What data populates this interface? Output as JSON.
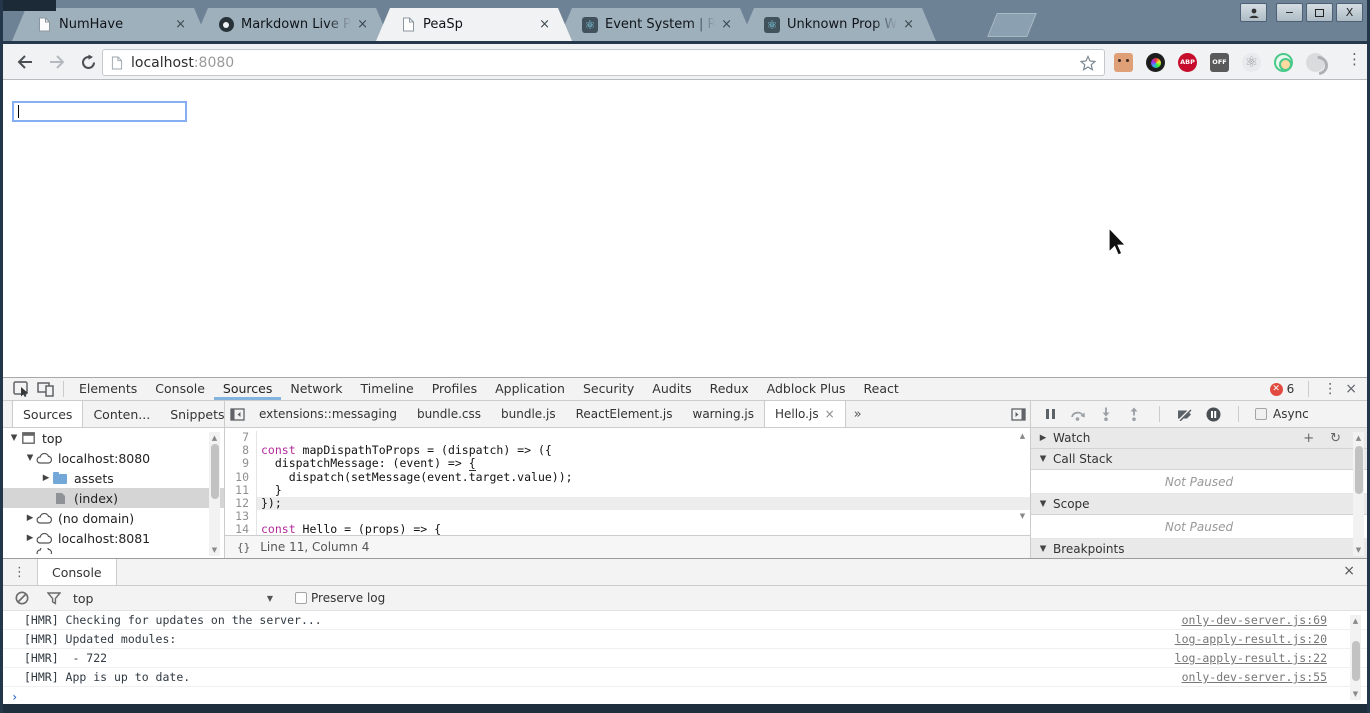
{
  "colors": {
    "frame": "#6e8296",
    "frame_dark": "#1f2e3d",
    "active_tab": "#f1f2f3",
    "tab_underline": "#84b3dd",
    "error_red": "#e04a3f",
    "keyword_magenta": "#b22a9a",
    "prompt_blue": "#3b6fd4",
    "focus_ring_blue": "#85aff2",
    "selected_row_gray": "#d5d5d5"
  },
  "browser": {
    "close_glyph": "×",
    "tabs": [
      {
        "title": "NumHave",
        "icon": "page-icon"
      },
      {
        "title": "Markdown Live Pre",
        "icon": "markdown-icon"
      },
      {
        "title": "PeaSp",
        "icon": "page-icon"
      },
      {
        "title": "Event System | Rea",
        "icon": "react-icon"
      },
      {
        "title": "Unknown Prop War",
        "icon": "react-icon"
      }
    ],
    "window_controls": {
      "minimize": "−",
      "close": "X"
    },
    "url": {
      "host": "localhost",
      "port": ":8080"
    },
    "extensions": [
      "face-icon",
      "color-picker-icon",
      "adblock-plus-icon",
      "off-icon",
      "react-gray-icon",
      "target-icon",
      "swirl-icon"
    ],
    "ext_labels": {
      "abp": "ABP",
      "off": "OFF",
      "react": "⚛"
    },
    "menu_glyph": "⋮"
  },
  "page": {
    "input_value": ""
  },
  "devtools": {
    "tabs": [
      "Elements",
      "Console",
      "Sources",
      "Network",
      "Timeline",
      "Profiles",
      "Application",
      "Security",
      "Audits",
      "Redux",
      "Adblock Plus",
      "React"
    ],
    "active_tab": "Sources",
    "error_count": "6",
    "menu_glyph": "⋮",
    "close_glyph": "×",
    "sources_nav": {
      "tabs": [
        "Sources",
        "Conten...",
        "Snippets"
      ],
      "menu_glyph": "⋮"
    },
    "tree": [
      {
        "arrow": "▼",
        "label": "top",
        "icon": "frame-icon"
      },
      {
        "arrow": "▼",
        "label": "localhost:8080",
        "icon": "cloud-icon"
      },
      {
        "arrow": "▶",
        "label": "assets",
        "icon": "folder-icon"
      },
      {
        "arrow": "",
        "label": "(index)",
        "icon": "file-icon"
      },
      {
        "arrow": "▶",
        "label": "(no domain)",
        "icon": "cloud-icon"
      },
      {
        "arrow": "▶",
        "label": "localhost:8081",
        "icon": "cloud-icon"
      }
    ],
    "editor": {
      "tabs": [
        "extensions::messaging",
        "bundle.css",
        "bundle.js",
        "ReactElement.js",
        "warning.js"
      ],
      "active_tab": "Hello.js",
      "close_glyph": "×",
      "overflow_glyph": "»",
      "code_lines": [
        {
          "n": "7",
          "kw": "",
          "pre": "",
          "post": "",
          "u": ""
        },
        {
          "n": "8",
          "kw": "const",
          "pre": "",
          "post": " mapDispathToProps = (dispatch) => ({",
          "u": ""
        },
        {
          "n": "9",
          "kw": "",
          "pre": "  dispatchMessage: (event) => ",
          "post": "",
          "u": "{"
        },
        {
          "n": "10",
          "kw": "",
          "pre": "    dispatch(setMessage(event.target.value));",
          "post": "",
          "u": ""
        },
        {
          "n": "11",
          "kw": "",
          "pre": "  ",
          "post": "",
          "u": "}"
        },
        {
          "n": "12",
          "kw": "",
          "pre": "});",
          "post": "",
          "u": ""
        },
        {
          "n": "13",
          "kw": "",
          "pre": "",
          "post": "",
          "u": ""
        },
        {
          "n": "14",
          "kw": "const",
          "pre": "",
          "post": " Hello = (props) => {",
          "u": ""
        }
      ],
      "status": {
        "pretty_print": "{}",
        "cursor_position": "Line 11, Column 4"
      }
    },
    "debugger": {
      "async_label": "Async",
      "watch": {
        "arrow": "▶",
        "title": "Watch",
        "add_glyph": "+",
        "refresh_glyph": "↻"
      },
      "sections": [
        {
          "arrow": "▼",
          "title": "Call Stack",
          "state": "Not Paused"
        },
        {
          "arrow": "▼",
          "title": "Scope",
          "state": "Not Paused"
        },
        {
          "arrow": "▼",
          "title": "Breakpoints",
          "state": ""
        }
      ]
    }
  },
  "console": {
    "menu_glyph": "⋮",
    "tab_label": "Console",
    "close_glyph": "×",
    "context": "top",
    "context_caret": "▼",
    "preserve_log_label": "Preserve log",
    "messages": [
      {
        "text": "[HMR] Checking for updates on the server...",
        "link": "only-dev-server.js:69"
      },
      {
        "text": "[HMR] Updated modules:",
        "link": "log-apply-result.js:20"
      },
      {
        "text": "[HMR]  - 722",
        "link": "log-apply-result.js:22"
      },
      {
        "text": "[HMR] App is up to date.",
        "link": "only-dev-server.js:55"
      }
    ],
    "prompt_glyph": "›"
  }
}
